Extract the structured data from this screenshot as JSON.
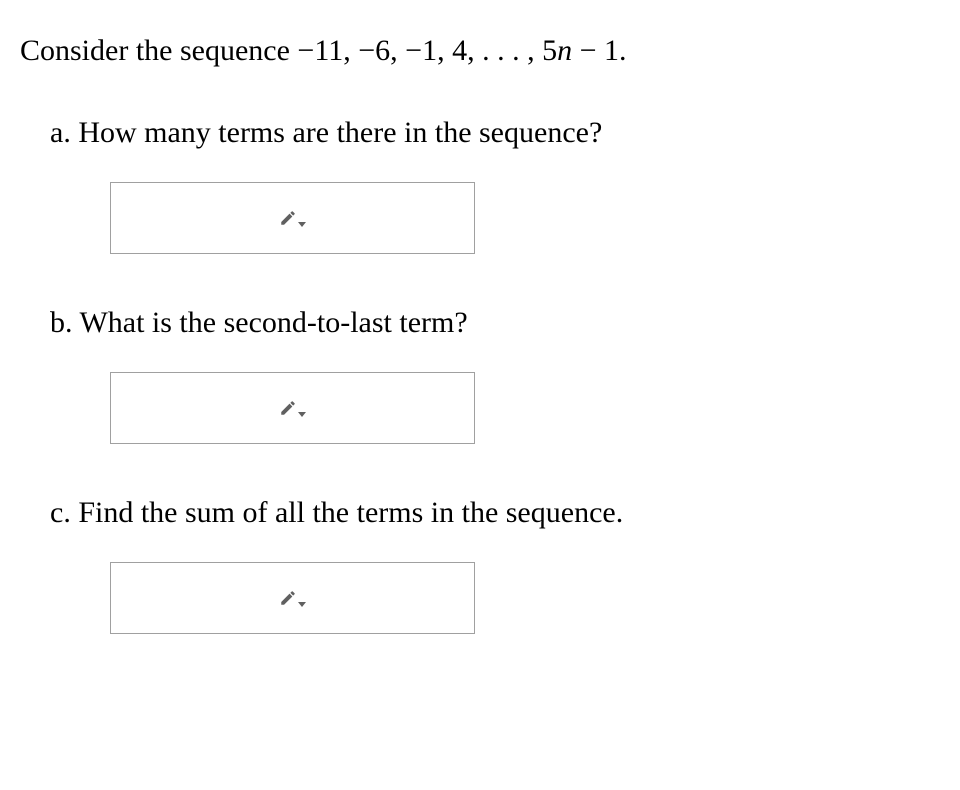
{
  "intro": {
    "prefix": "Consider the sequence ",
    "sequence": "−11, −6, −1, 4, . . . , 5",
    "var": "n",
    "suffix": " − 1."
  },
  "parts": {
    "a": {
      "label": "a. How many terms are there in the sequence?"
    },
    "b": {
      "label": "b. What is the second-to-last term?"
    },
    "c": {
      "label": "c. Find the sum of all the terms in the sequence."
    }
  }
}
